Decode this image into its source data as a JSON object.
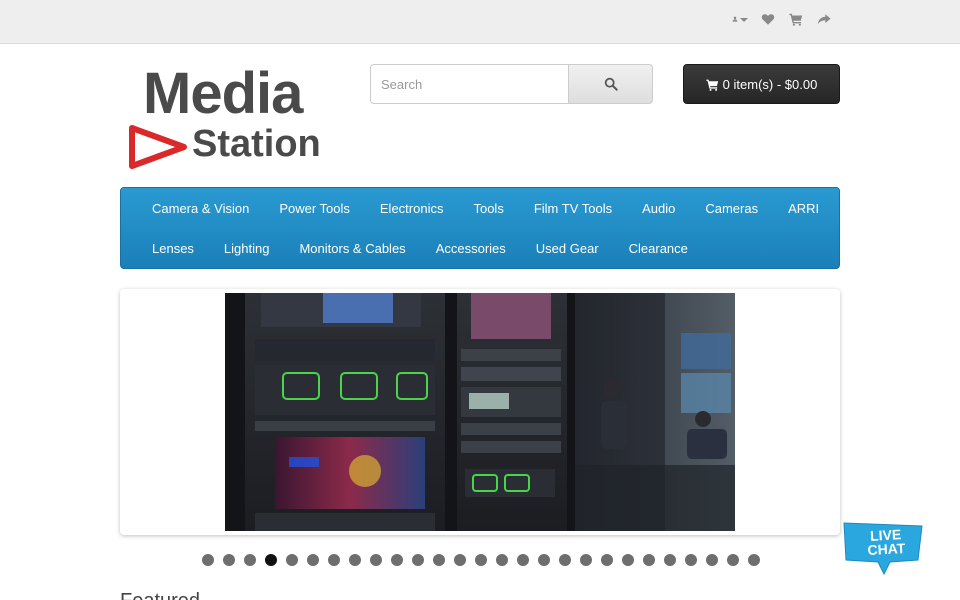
{
  "topbar": {
    "icons": [
      "user-icon",
      "heart-icon",
      "cart-icon",
      "share-icon"
    ]
  },
  "logo": {
    "line1": "Media",
    "line2": "Station"
  },
  "search": {
    "placeholder": "Search",
    "icon": "search-icon"
  },
  "cart": {
    "label": "0 item(s) - $0.00",
    "icon": "cart-icon"
  },
  "menu": {
    "row1": [
      "Camera & Vision",
      "Power Tools",
      "Electronics",
      "Tools",
      "Film TV Tools",
      "Audio",
      "Cameras",
      "ARRI"
    ],
    "row2": [
      "Lenses",
      "Lighting",
      "Monitors & Cables",
      "Accessories",
      "Used Gear",
      "Clearance"
    ]
  },
  "slideshow": {
    "total_slides": 27,
    "active_index": 3
  },
  "featured": {
    "heading": "Featured"
  },
  "livechat": {
    "line1": "LIVE",
    "line2": "CHAT"
  },
  "colors": {
    "menu": "#1e88c3",
    "cart_button": "#2f2f2f",
    "logo_red": "#d9292b",
    "livechat": "#2aa7df"
  }
}
